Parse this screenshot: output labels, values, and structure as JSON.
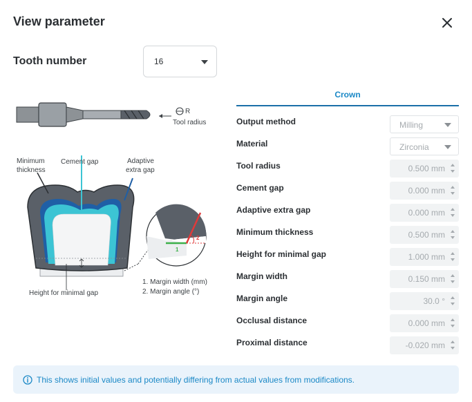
{
  "dialog": {
    "title": "View parameter",
    "close_icon": "close-icon"
  },
  "tooth": {
    "label": "Tooth number",
    "value": "16"
  },
  "illustration": {
    "tool_radius_symbol": "R",
    "tool_radius_label": "Tool radius",
    "min_thickness_line1": "Minimum",
    "min_thickness_line2": "thickness",
    "cement_gap": "Cement gap",
    "adaptive_line1": "Adaptive",
    "adaptive_line2": "extra gap",
    "height_minimal_gap": "Height for minimal gap",
    "margin_note_1": "1. Margin width (mm)",
    "margin_note_2": "2. Margin angle (°)",
    "detail_1": "1",
    "detail_2": "2",
    "colors": {
      "gray_crown": "#5a6068",
      "dark_blue_gap": "#1f5fa6",
      "cyan_gap": "#3cc4d4",
      "green_margin": "#3cb04a",
      "red_angle": "#e03a3a"
    }
  },
  "tabs": {
    "crown": "Crown"
  },
  "params": {
    "output_method": {
      "label": "Output method",
      "value": "Milling"
    },
    "material": {
      "label": "Material",
      "value": "Zirconia"
    },
    "tool_radius": {
      "label": "Tool radius",
      "value": "0.500  mm"
    },
    "cement_gap": {
      "label": "Cement gap",
      "value": "0.000  mm"
    },
    "adaptive_extra_gap": {
      "label": "Adaptive extra gap",
      "value": "0.000  mm"
    },
    "minimum_thickness": {
      "label": "Minimum thickness",
      "value": "0.500  mm"
    },
    "height_minimal_gap": {
      "label": "Height for minimal gap",
      "value": "1.000  mm"
    },
    "margin_width": {
      "label": "Margin width",
      "value": "0.150  mm"
    },
    "margin_angle": {
      "label": "Margin angle",
      "value": "30.0  °"
    },
    "occlusal_distance": {
      "label": "Occlusal distance",
      "value": "0.000  mm"
    },
    "proximal_distance": {
      "label": "Proximal distance",
      "value": "-0.020  mm"
    }
  },
  "info": {
    "icon": "info-icon",
    "text": "This shows initial values and potentially differing from actual values from modifications."
  }
}
